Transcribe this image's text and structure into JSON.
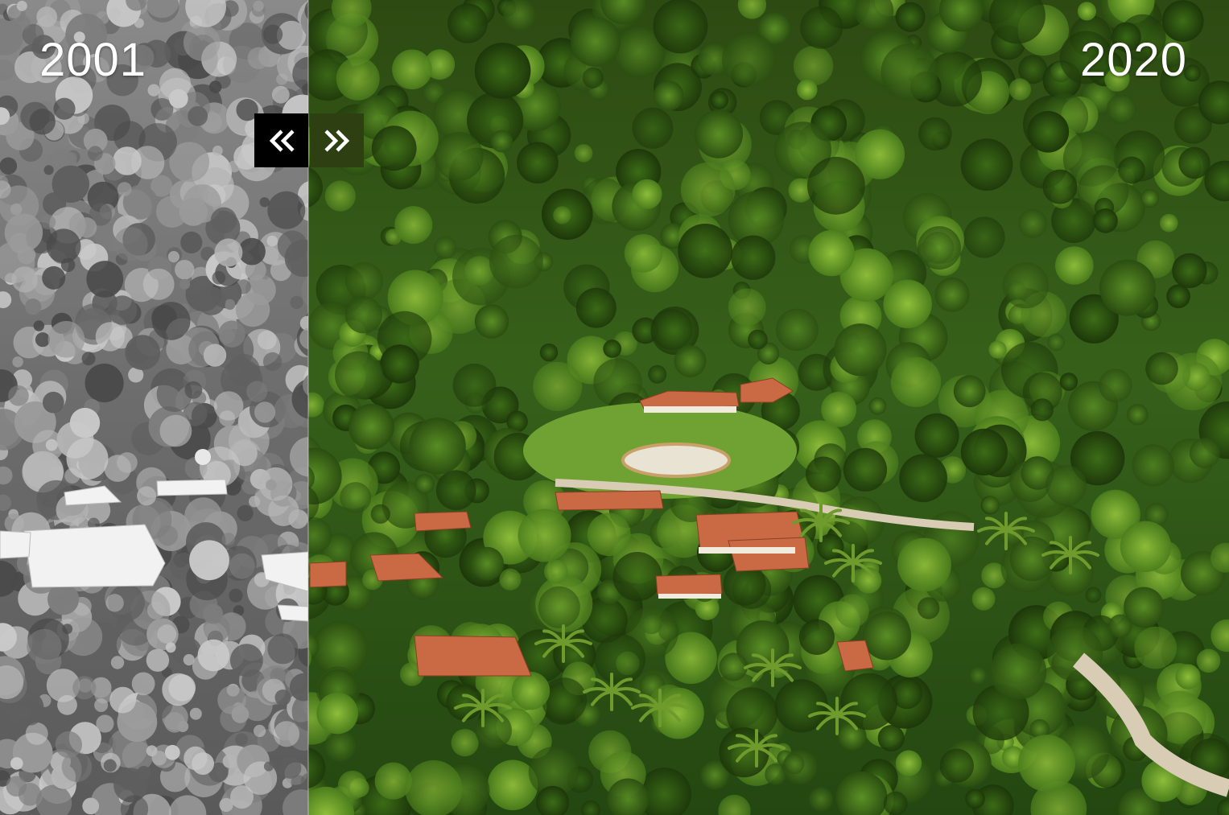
{
  "comparison": {
    "before_label": "2001",
    "after_label": "2020",
    "slider_position": 0.251
  },
  "controls": {
    "left_icon": "chevron-double-left-icon",
    "right_icon": "chevron-double-right-icon"
  },
  "colors": {
    "left_button_bg": "#000000",
    "right_button_bg": "#2e3f12",
    "label_color": "#ffffff"
  }
}
